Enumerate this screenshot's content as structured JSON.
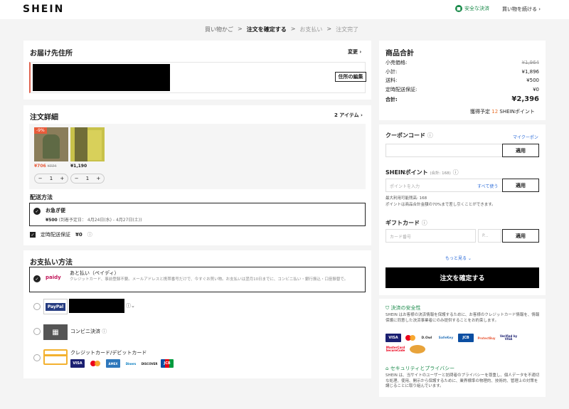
{
  "header": {
    "logo": "SHEIN",
    "secure_label": "安全な決済",
    "continue_label": "買い物を続ける ›"
  },
  "breadcrumb": {
    "items": [
      "買い物かご",
      ">",
      "注文を確定する",
      ">",
      "お支払い",
      ">",
      "注文完了"
    ]
  },
  "address": {
    "title": "お届け先住所",
    "change_label": "変更 ›",
    "edit_button": "住所の編集"
  },
  "order": {
    "title": "注文詳細",
    "count_label": "2 アイテム ›",
    "items": [
      {
        "badge": "-9%",
        "price": "¥706",
        "old_price": "¥774",
        "qty": "1"
      },
      {
        "price": "¥1,190",
        "qty": "1"
      }
    ],
    "shipping_title": "配送方法",
    "shipping_name": "お急ぎ便",
    "shipping_price": "¥500",
    "shipping_date": "(到着予定日：  4月24日(水) - 4月27日(土))",
    "guarantee_label": "定時配送保証",
    "guarantee_price": "¥0"
  },
  "payment": {
    "title": "お支払い方法",
    "paidy_label": "paidy",
    "paidy_title": "あと払い（ペイディ）",
    "paidy_desc": "クレジットカード、事前登録不要。メールアドレスと携帯番号だけで、今すぐお買い物。お支払いは翌月10日までに、コンビニ払い・銀行振込・口座振替で。",
    "paypal_label": "PayPal",
    "konbini_label": "コンビニ決済",
    "card_label": "クレジットカード/デビットカード",
    "card_logos": [
      "VISA",
      "MC",
      "AMEX",
      "Diners",
      "DISCOVER",
      "JCB"
    ]
  },
  "summary": {
    "title": "商品合計",
    "rows": [
      {
        "label": "小売価格:",
        "value": "¥1,964"
      },
      {
        "label": "小計:",
        "value": "¥1,896"
      },
      {
        "label": "送料:",
        "value": "¥500"
      },
      {
        "label": "定時配送保証:",
        "value": "¥0"
      }
    ],
    "total_label": "合計:",
    "total_value": "¥2,396",
    "points_prefix": "獲得予定",
    "points_value": "12",
    "points_suffix": "SHEINポイント"
  },
  "coupon": {
    "title": "クーポンコード",
    "my_coupon": "マイクーポン",
    "apply": "適用"
  },
  "points": {
    "title": "SHEINポイント",
    "sub": "(合計: 168)",
    "placeholder": "ポイントを入力",
    "use_all": "すべて使う",
    "apply": "適用",
    "max_note": "最大利用可能残高: 168",
    "rule_note": "ポイントは商品合計金額の70%まで差し引くことができます。"
  },
  "gift": {
    "title": "ギフトカード",
    "card_placeholder": "カード番号",
    "pin_placeholder": "P...",
    "apply": "適用"
  },
  "more_label": "もっと見る ⌄",
  "confirm_label": "注文を確定する",
  "security": {
    "pay_title": "決済の安全性",
    "pay_desc": "SHEIN はお客様の決済情報を保護するために、お客様のクレジットカード情報を、情報保護に同意した決済事業者にのみ提供することをお約束します。",
    "logos": [
      "VISA",
      "MC",
      "D.Owl",
      "SafeKey",
      "JCB",
      "ProtectBuy",
      "Verified by VISA",
      "MasterCard SecureCode"
    ],
    "privacy_title": "セキュリティとプライバシー",
    "privacy_desc": "SHEIN は、当サイトのユーザーと訪問者のプライバシーを尊重し、個人データを不適切な処理、使用、開示から保護するために、業界標準の物理的、技術的、管理上の対策を講じることに取り組んでいます。"
  }
}
